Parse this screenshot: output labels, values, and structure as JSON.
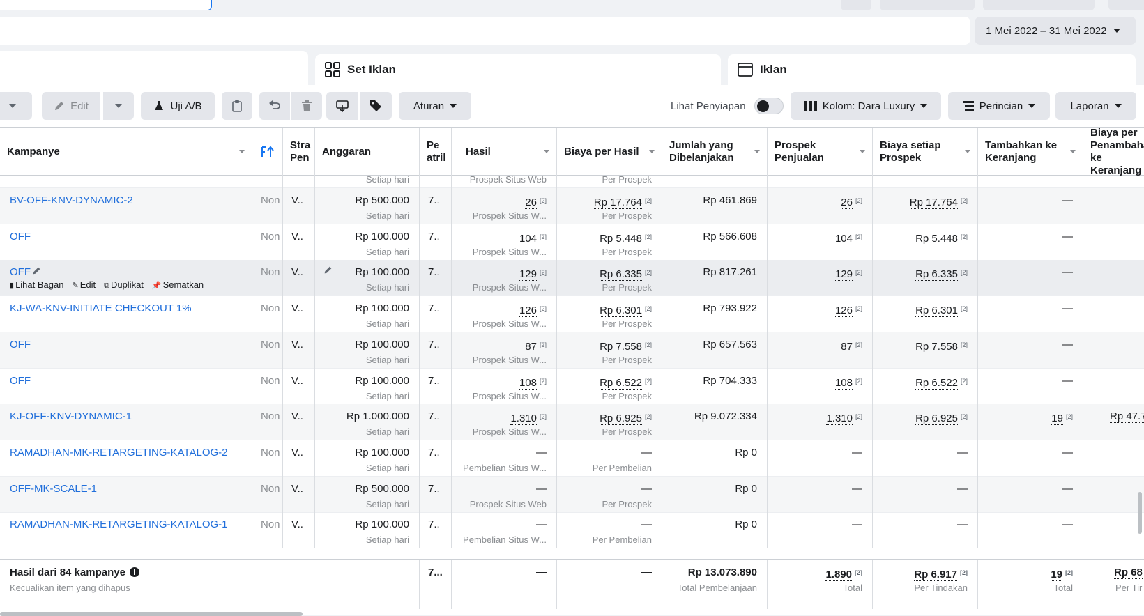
{
  "date_range": "1 Mei 2022 – 31 Mei 2022",
  "tabs": {
    "set_iklan": "Set Iklan",
    "iklan": "Iklan"
  },
  "toolbar": {
    "edit": "Edit",
    "ab_test": "Uji A/B",
    "rules": "Aturan",
    "preview_label": "Lihat Penyiapan",
    "columns": "Kolom: Dara Luxury",
    "breakdown": "Perincian",
    "reports": "Laporan"
  },
  "headers": {
    "campaign": "Kampanye",
    "strategy": "Stra Pen",
    "budget": "Anggaran",
    "attribution": "Pe atril",
    "results": "Hasil",
    "cost_per_result": "Biaya per Hasil",
    "amount_spent": "Jumlah yang Dibelanjakan",
    "sales_leads": "Prospek Penjualan",
    "cost_per_lead": "Biaya setiap Prospek",
    "add_to_cart": "Tambahkan ke Keranjang",
    "cost_per_add_to_cart": "Biaya per Penambahan ke Keranjang"
  },
  "partial_row": {
    "budget_sub": "Setiap hari",
    "results_sub": "Prospek Situs Web",
    "cost_sub": "Per Prospek"
  },
  "rows": [
    {
      "name": "BV-OFF-KNV-DYNAMIC-2",
      "delivery": "Non",
      "strategy": "V..",
      "budget": "Rp 500.000",
      "budget_sub": "Setiap hari",
      "attr": "7..",
      "results": "26",
      "results_sub": "Prospek Situs W...",
      "cpr": "Rp 17.764",
      "cpr_sub": "Per Prospek",
      "spent": "Rp 461.869",
      "leads": "26",
      "cpl": "Rp 17.764",
      "atc": "—",
      "catc": ""
    },
    {
      "name": "OFF",
      "delivery": "Non",
      "strategy": "V..",
      "budget": "Rp 100.000",
      "budget_sub": "Setiap hari",
      "attr": "7..",
      "results": "104",
      "results_sub": "Prospek Situs W...",
      "cpr": "Rp 5.448",
      "cpr_sub": "Per Prospek",
      "spent": "Rp 566.608",
      "leads": "104",
      "cpl": "Rp 5.448",
      "atc": "—",
      "catc": ""
    },
    {
      "name": "OFF",
      "delivery": "Non",
      "strategy": "V..",
      "budget": "Rp 100.000",
      "budget_sub": "Setiap hari",
      "attr": "7..",
      "results": "129",
      "results_sub": "Prospek Situs W...",
      "cpr": "Rp 6.335",
      "cpr_sub": "Per Prospek",
      "spent": "Rp 817.261",
      "leads": "129",
      "cpl": "Rp 6.335",
      "atc": "—",
      "catc": ""
    },
    {
      "name": "KJ-WA-KNV-INITIATE CHECKOUT 1%",
      "delivery": "Non",
      "strategy": "V..",
      "budget": "Rp 100.000",
      "budget_sub": "Setiap hari",
      "attr": "7..",
      "results": "126",
      "results_sub": "Prospek Situs W...",
      "cpr": "Rp 6.301",
      "cpr_sub": "Per Prospek",
      "spent": "Rp 793.922",
      "leads": "126",
      "cpl": "Rp 6.301",
      "atc": "—",
      "catc": ""
    },
    {
      "name": "OFF",
      "delivery": "Non",
      "strategy": "V..",
      "budget": "Rp 100.000",
      "budget_sub": "Setiap hari",
      "attr": "7..",
      "results": "87",
      "results_sub": "Prospek Situs W...",
      "cpr": "Rp 7.558",
      "cpr_sub": "Per Prospek",
      "spent": "Rp 657.563",
      "leads": "87",
      "cpl": "Rp 7.558",
      "atc": "—",
      "catc": ""
    },
    {
      "name": "OFF",
      "delivery": "Non",
      "strategy": "V..",
      "budget": "Rp 100.000",
      "budget_sub": "Setiap hari",
      "attr": "7..",
      "results": "108",
      "results_sub": "Prospek Situs W...",
      "cpr": "Rp 6.522",
      "cpr_sub": "Per Prospek",
      "spent": "Rp 704.333",
      "leads": "108",
      "cpl": "Rp 6.522",
      "atc": "—",
      "catc": ""
    },
    {
      "name": "KJ-OFF-KNV-DYNAMIC-1",
      "delivery": "Non",
      "strategy": "V..",
      "budget": "Rp 1.000.000",
      "budget_sub": "Setiap hari",
      "attr": "7..",
      "results": "1.310",
      "results_sub": "Prospek Situs W...",
      "cpr": "Rp 6.925",
      "cpr_sub": "Per Prospek",
      "spent": "Rp 9.072.334",
      "leads": "1.310",
      "cpl": "Rp 6.925",
      "atc": "19",
      "catc": "Rp 47.7"
    },
    {
      "name": "RAMADHAN-MK-RETARGETING-KATALOG-2",
      "delivery": "Non",
      "strategy": "V..",
      "budget": "Rp 100.000",
      "budget_sub": "Setiap hari",
      "attr": "7..",
      "results": "—",
      "results_sub": "Pembelian Situs W...",
      "cpr": "—",
      "cpr_sub": "Per Pembelian",
      "spent": "Rp 0",
      "leads": "—",
      "cpl": "—",
      "atc": "—",
      "catc": ""
    },
    {
      "name": "OFF-MK-SCALE-1",
      "delivery": "Non",
      "strategy": "V..",
      "budget": "Rp 500.000",
      "budget_sub": "Setiap hari",
      "attr": "7..",
      "results": "—",
      "results_sub": "Prospek Situs Web",
      "cpr": "—",
      "cpr_sub": "Per Prospek",
      "spent": "Rp 0",
      "leads": "—",
      "cpl": "—",
      "atc": "—",
      "catc": ""
    },
    {
      "name": "RAMADHAN-MK-RETARGETING-KATALOG-1",
      "delivery": "Non",
      "strategy": "V..",
      "budget": "Rp 100.000",
      "budget_sub": "Setiap hari",
      "attr": "7..",
      "results": "—",
      "results_sub": "Pembelian Situs W...",
      "cpr": "—",
      "cpr_sub": "Per Pembelian",
      "spent": "Rp 0",
      "leads": "—",
      "cpl": "—",
      "atc": "—",
      "catc": ""
    }
  ],
  "hover_actions": {
    "chart": "Lihat Bagan",
    "edit": "Edit",
    "duplicate": "Duplikat",
    "pin": "Sematkan"
  },
  "footer": {
    "title": "Hasil dari 84 kampanye",
    "subtitle": "Kecualikan item yang dihapus",
    "attr": "7...",
    "results": "—",
    "cpr": "—",
    "spent": "Rp 13.073.890",
    "spent_sub": "Total Pembelanjaan",
    "leads": "1.890",
    "leads_sub": "Total",
    "cpl": "Rp 6.917",
    "cpl_sub": "Per Tindakan",
    "atc": "19",
    "atc_sub": "Total",
    "catc": "Rp 68",
    "catc_sub": "Per Tir"
  },
  "sup_marker": "[2]"
}
